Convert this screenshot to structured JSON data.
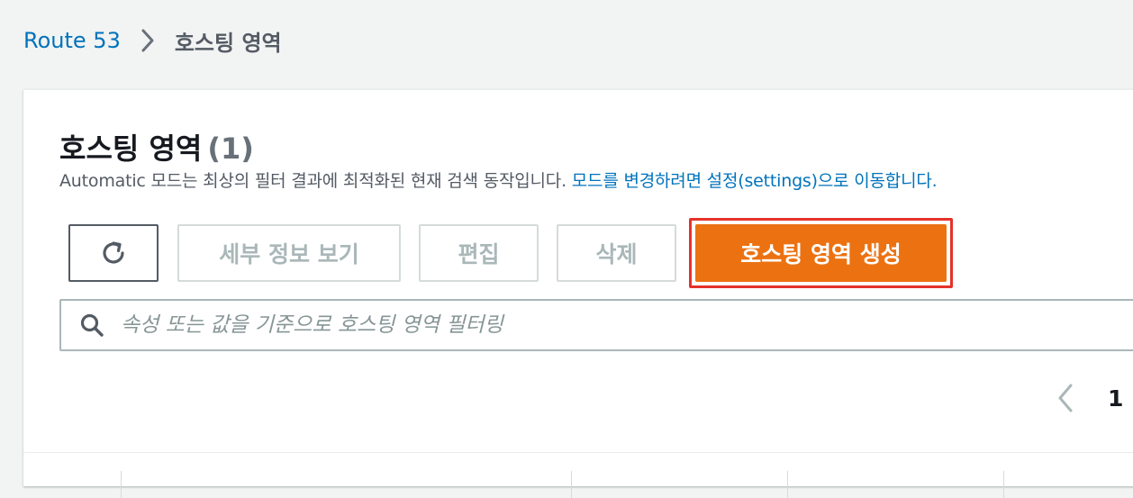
{
  "breadcrumb": {
    "root": "Route 53",
    "current": "호스팅 영역"
  },
  "panel": {
    "title": "호스팅 영역",
    "count": "(1)",
    "description_text": "Automatic 모드는 최상의 필터 결과에 최적화된 현재 검색 동작입니다. ",
    "description_link": "모드를 변경하려면 설정(settings)으로 이동합니다."
  },
  "toolbar": {
    "refresh_icon": "refresh-icon",
    "details_label": "세부 정보 보기",
    "edit_label": "편집",
    "delete_label": "삭제",
    "create_label": "호스팅 영역 생성"
  },
  "search": {
    "placeholder": "속성 또는 값을 기준으로 호스팅 영역 필터링",
    "value": ""
  },
  "pagination": {
    "current_page": "1"
  },
  "colors": {
    "accent_orange": "#ec7211",
    "link_blue": "#0073bb",
    "highlight_red": "#e4322b",
    "background": "#f2f3f3"
  }
}
